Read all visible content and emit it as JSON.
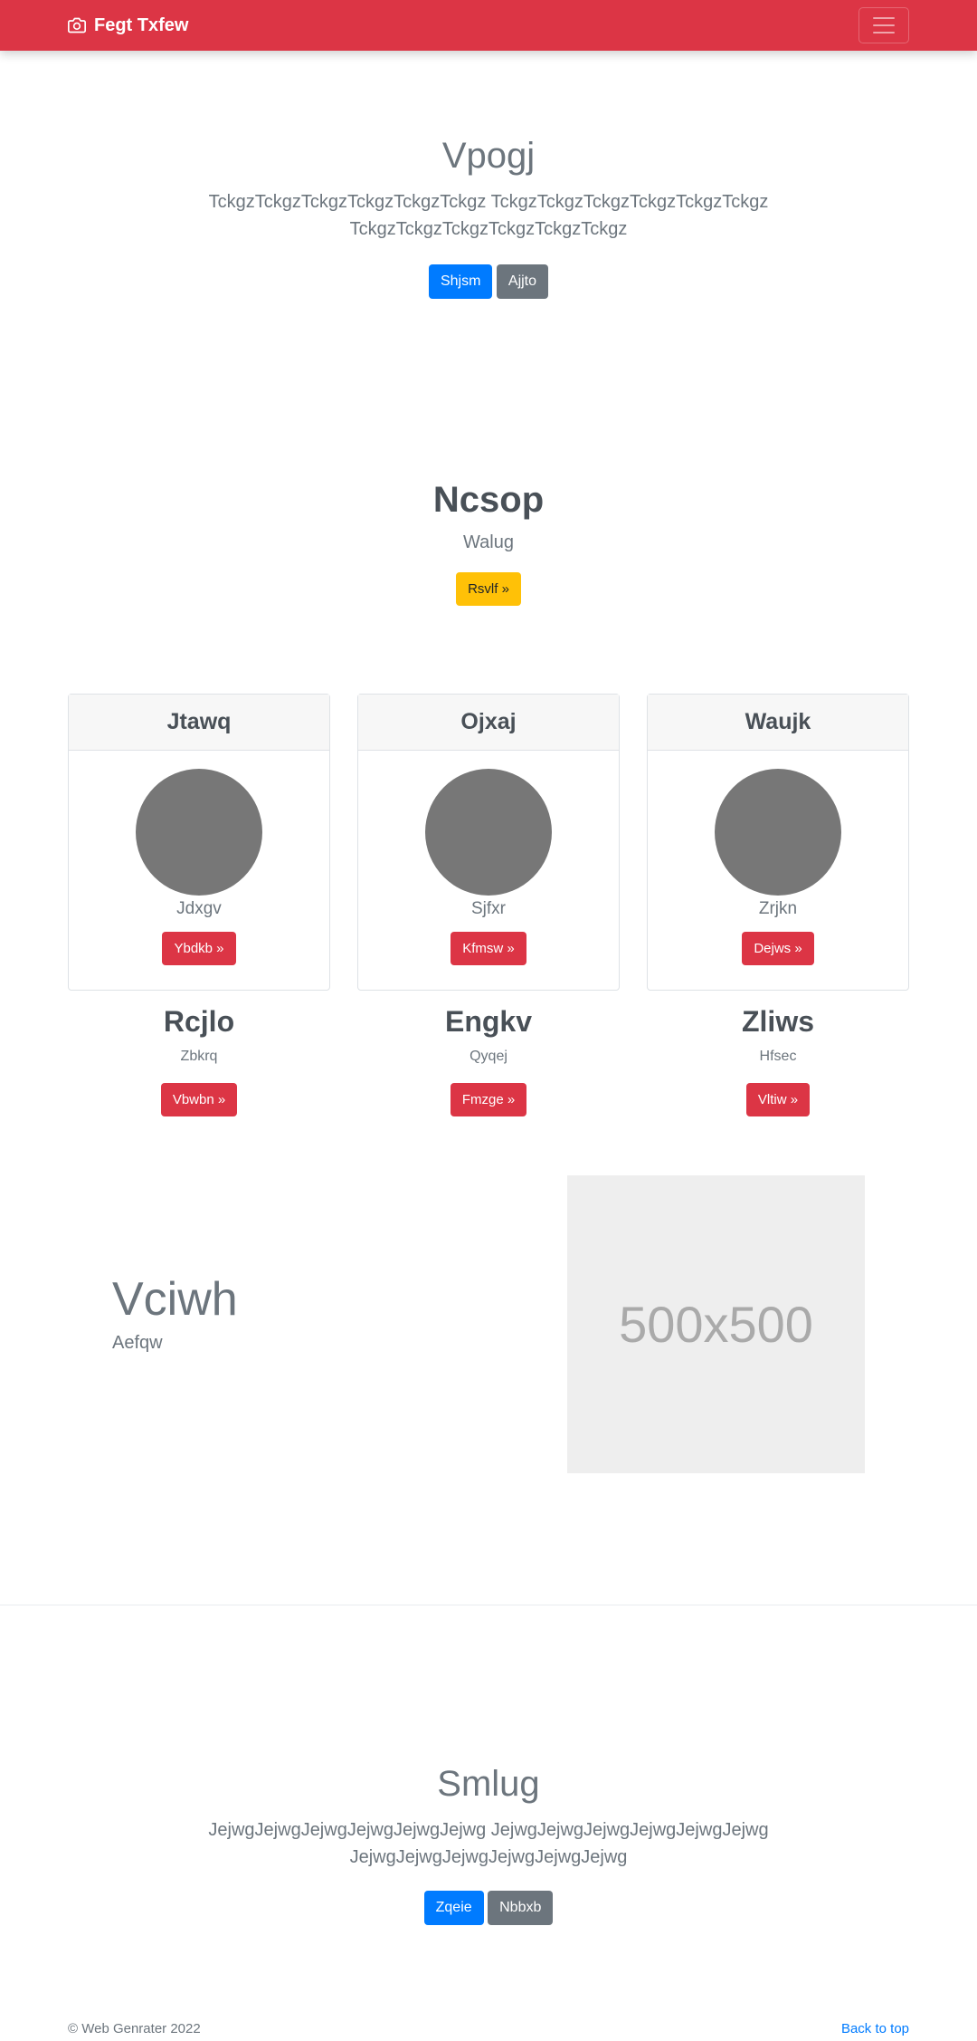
{
  "navbar": {
    "brand": "Fegt Txfew",
    "colors": {
      "background": "#dc3545"
    }
  },
  "hero": {
    "title": "Vpogj",
    "lead_line1": "TckgzTckgzTckgzTckgzTckgzTckgz TckgzTckgzTckgzTckgzTckgzTckgz",
    "lead_line2": "TckgzTckgzTckgzTckgzTckgzTckgz",
    "primary_button": "Shjsm",
    "secondary_button": "Ajjto"
  },
  "callout": {
    "title": "Ncsop",
    "subtitle": "Walug",
    "button": "Rsvlf »"
  },
  "cards": [
    {
      "header": "Jtawq",
      "text": "Jdxgv",
      "button": "Ybdkb »"
    },
    {
      "header": "Ojxaj",
      "text": "Sjfxr",
      "button": "Kfmsw »"
    },
    {
      "header": "Waujk",
      "text": "Zrjkn",
      "button": "Dejws »"
    }
  ],
  "columns": [
    {
      "title": "Rcjlo",
      "subtitle": "Zbkrq",
      "button": "Vbwbn »"
    },
    {
      "title": "Engkv",
      "subtitle": "Qyqej",
      "button": "Fmzge »"
    },
    {
      "title": "Zliws",
      "subtitle": "Hfsec",
      "button": "Vltiw »"
    }
  ],
  "feature": {
    "title": "Vciwh",
    "subtitle": "Aefqw",
    "image_label": "500x500"
  },
  "closing": {
    "title": "Smlug",
    "lead_line1": "JejwgJejwgJejwgJejwgJejwgJejwg JejwgJejwgJejwgJejwgJejwgJejwg",
    "lead_line2": "JejwgJejwgJejwgJejwgJejwgJejwg",
    "primary_button": "Zqeie",
    "secondary_button": "Nbbxb"
  },
  "footer": {
    "copyright": "© Web Genrater 2022",
    "back_to_top": "Back to top"
  }
}
